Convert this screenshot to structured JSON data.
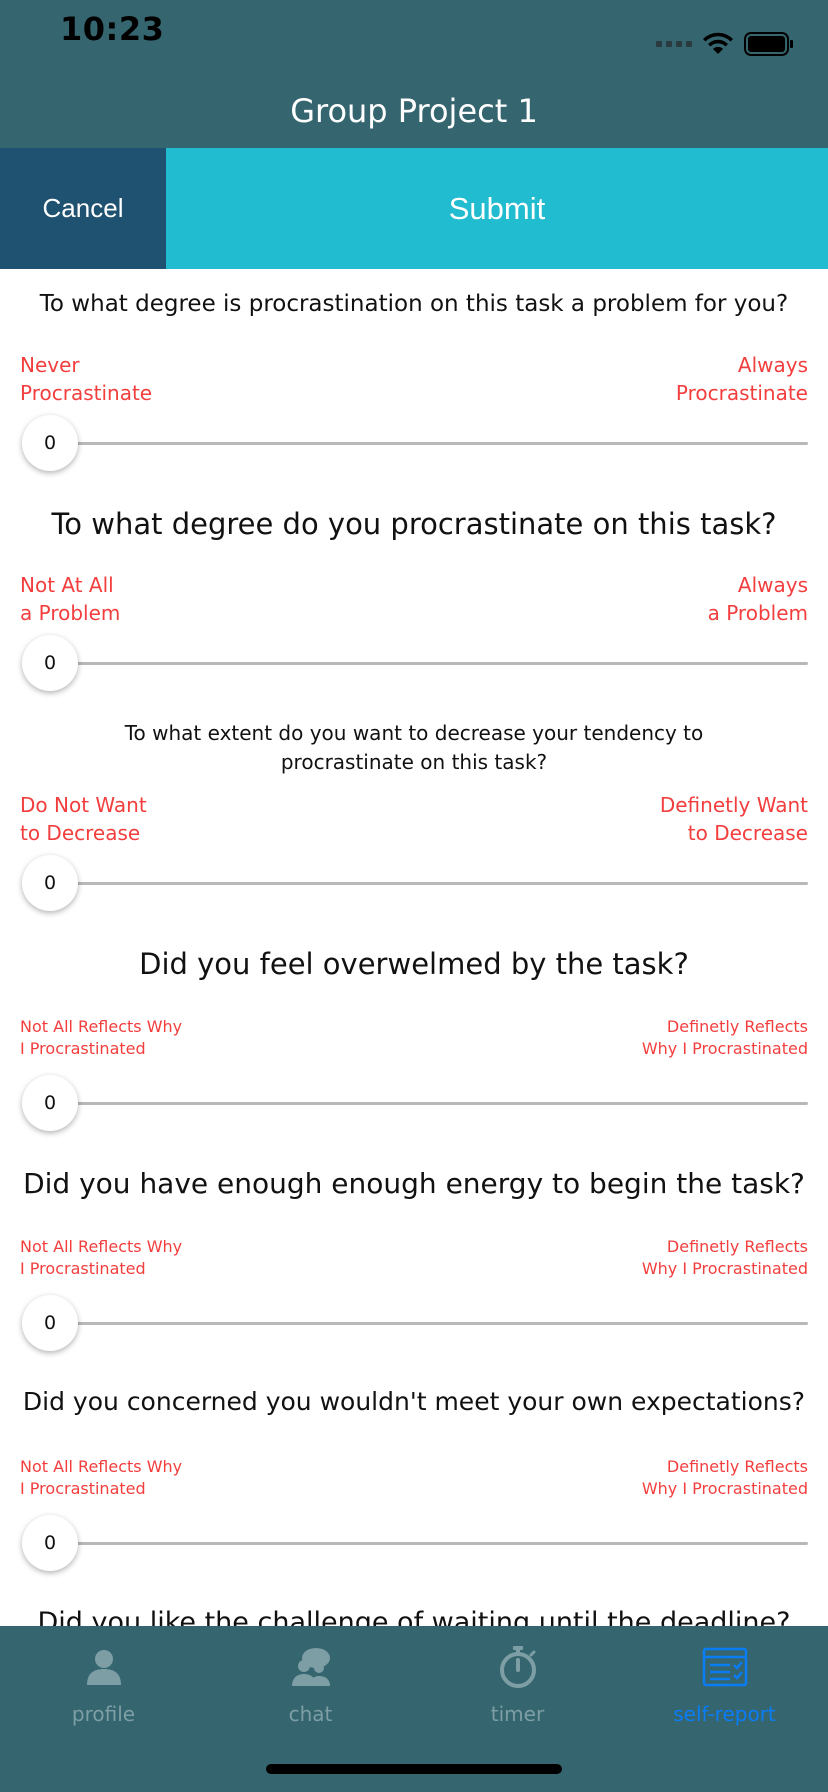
{
  "status": {
    "time": "10:23"
  },
  "header": {
    "title": "Group Project 1"
  },
  "actions": {
    "cancel": "Cancel",
    "submit": "Submit"
  },
  "questions": [
    {
      "text": "To what degree is procrastination on this task a problem for you?",
      "left": [
        "Never",
        "Procrastinate"
      ],
      "right": [
        "Always",
        "Procrastinate"
      ],
      "value": "0"
    },
    {
      "text": "To what degree do you procrastinate on this task?",
      "left": [
        "Not At All",
        "a Problem"
      ],
      "right": [
        "Always",
        "a Problem"
      ],
      "value": "0"
    },
    {
      "text": "To what extent do you want to decrease your tendency to procrastinate on this task?",
      "left": [
        "Do Not Want",
        "to Decrease"
      ],
      "right": [
        "Definetly Want",
        "to Decrease"
      ],
      "value": "0"
    },
    {
      "text": "Did you feel overwelmed by the task?",
      "left": [
        "Not All Reflects Why",
        "I Procrastinated"
      ],
      "right": [
        "Definetly Reflects",
        "Why I Procrastinated"
      ],
      "value": "0"
    },
    {
      "text": "Did you have enough enough energy to begin the task?",
      "left": [
        "Not All Reflects Why",
        "I Procrastinated"
      ],
      "right": [
        "Definetly Reflects",
        "Why I Procrastinated"
      ],
      "value": "0"
    },
    {
      "text": "Did you concerned you wouldn't meet your own expectations?",
      "left": [
        "Not All Reflects Why",
        "I Procrastinated"
      ],
      "right": [
        "Definetly Reflects",
        "Why I Procrastinated"
      ],
      "value": "0"
    },
    {
      "text": "Did you like the challenge of waiting until the deadline?"
    }
  ],
  "tabs": [
    {
      "label": "profile",
      "icon": "person-icon"
    },
    {
      "label": "chat",
      "icon": "chat-people-icon"
    },
    {
      "label": "timer",
      "icon": "stopwatch-icon"
    },
    {
      "label": "self-report",
      "icon": "report-list-icon",
      "active": true
    }
  ],
  "colors": {
    "header": "#35666f",
    "cancel": "#1f5170",
    "submit": "#21bccf",
    "scaleLabel": "#f33e3e",
    "activeTab": "#0a7cf5"
  }
}
